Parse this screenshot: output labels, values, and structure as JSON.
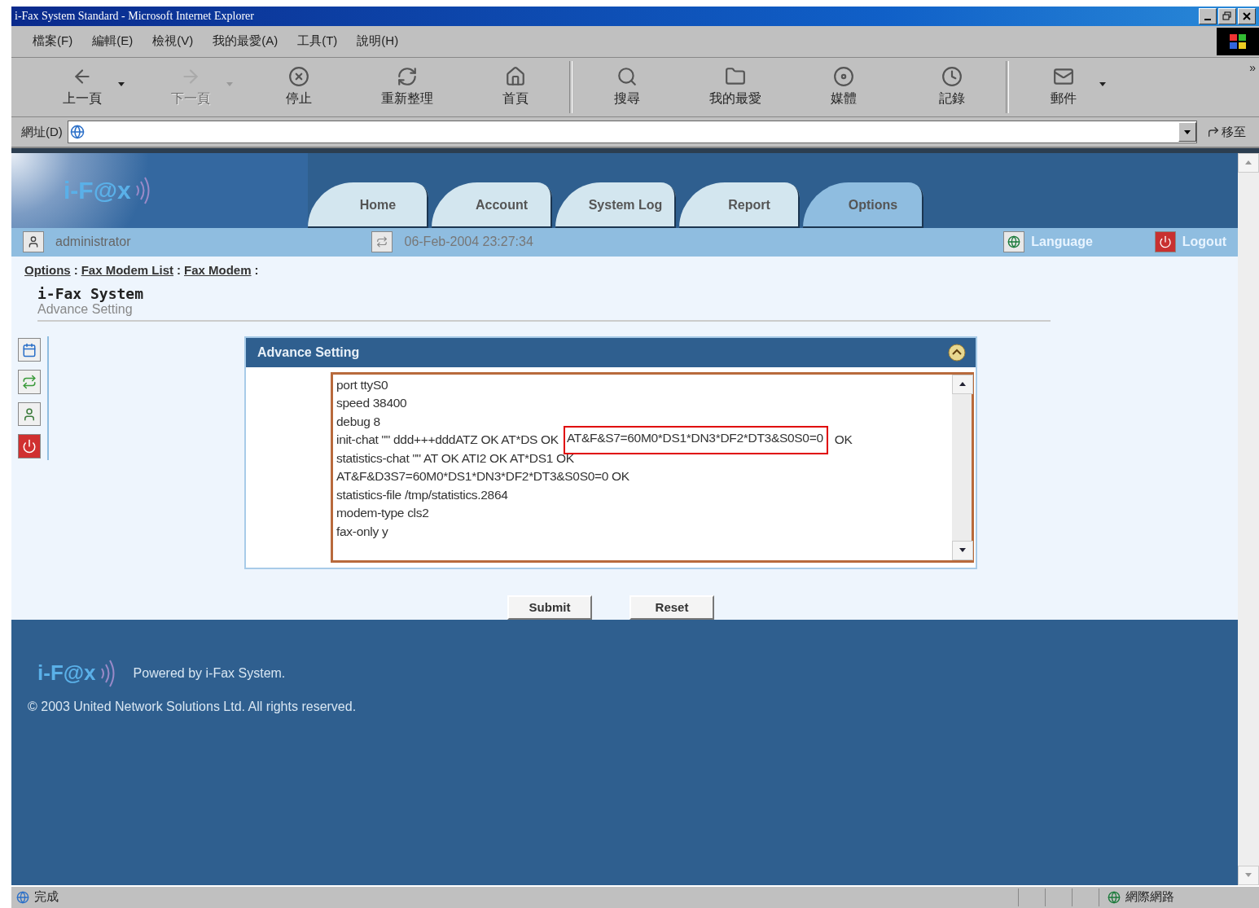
{
  "window": {
    "title": "i-Fax System Standard - Microsoft Internet Explorer"
  },
  "menu": [
    "檔案(F)",
    "編輯(E)",
    "檢視(V)",
    "我的最愛(A)",
    "工具(T)",
    "說明(H)"
  ],
  "toolbar": [
    {
      "kind": "back",
      "label": "上一頁",
      "disabled": false,
      "dropdown": true
    },
    {
      "kind": "forward",
      "label": "下一頁",
      "disabled": true,
      "dropdown": true
    },
    {
      "kind": "stop",
      "label": "停止",
      "disabled": false,
      "dropdown": false
    },
    {
      "kind": "refresh",
      "label": "重新整理",
      "disabled": false,
      "dropdown": false
    },
    {
      "kind": "home",
      "label": "首頁",
      "disabled": false,
      "dropdown": false
    },
    {
      "kind": "search",
      "label": "搜尋",
      "disabled": false,
      "dropdown": false
    },
    {
      "kind": "favorites",
      "label": "我的最愛",
      "disabled": false,
      "dropdown": false
    },
    {
      "kind": "media",
      "label": "媒體",
      "disabled": false,
      "dropdown": false
    },
    {
      "kind": "history",
      "label": "記錄",
      "disabled": false,
      "dropdown": false
    },
    {
      "kind": "mail",
      "label": "郵件",
      "disabled": false,
      "dropdown": true
    }
  ],
  "toolbar_more": "»",
  "address_bar": {
    "label": "網址(D)",
    "go": "移至"
  },
  "site": {
    "logo": "i-F@x",
    "tabs": [
      {
        "label": "Home",
        "selected": false
      },
      {
        "label": "Account",
        "selected": false
      },
      {
        "label": "System Log",
        "selected": false
      },
      {
        "label": "Report",
        "selected": false
      },
      {
        "label": "Options",
        "selected": true
      }
    ],
    "user": "administrator",
    "datetime": "06-Feb-2004 23:27:34",
    "language": "Language",
    "logout": "Logout",
    "breadcrumb": [
      "Options",
      "Fax Modem List",
      "Fax Modem"
    ],
    "breadcrumb_separator": ":",
    "title": "i-Fax System",
    "subtitle": "Advance Setting",
    "panel": {
      "title": "Advance Setting",
      "lines": [
        {
          "segments": [
            {
              "text": "port ttyS0",
              "highlighted": false
            }
          ]
        },
        {
          "segments": [
            {
              "text": "speed 38400",
              "highlighted": false
            }
          ]
        },
        {
          "segments": [
            {
              "text": "debug 8",
              "highlighted": false
            }
          ]
        },
        {
          "segments": [
            {
              "text": "init-chat \"\" ddd+++dddATZ OK AT*DS OK ",
              "highlighted": false
            },
            {
              "text": "AT&F&S7=60M0*DS1*DN3*DF2*DT3&S0S0=0",
              "highlighted": true
            },
            {
              "text": " OK",
              "highlighted": false
            }
          ]
        },
        {
          "segments": [
            {
              "text": "statistics-chat \"\" AT OK ATI2 OK AT*DS1 OK",
              "highlighted": false
            }
          ]
        },
        {
          "segments": [
            {
              "text": "AT&F&D3S7=60M0*DS1*DN3*DF2*DT3&S0S0=0 OK",
              "highlighted": false
            }
          ]
        },
        {
          "segments": [
            {
              "text": "statistics-file /tmp/statistics.2864",
              "highlighted": false
            }
          ]
        },
        {
          "segments": [
            {
              "text": "modem-type cls2",
              "highlighted": false
            }
          ]
        },
        {
          "segments": [
            {
              "text": "fax-only y",
              "highlighted": false
            }
          ]
        }
      ]
    },
    "buttons": [
      "Submit",
      "Reset"
    ],
    "footer": {
      "logo": "i-F@x",
      "powered": "Powered by i-Fax System.",
      "copyright": "© 2003 United Network Solutions Ltd. All rights reserved."
    }
  },
  "status_bar": {
    "text": "完成",
    "zone": "網際網路"
  }
}
